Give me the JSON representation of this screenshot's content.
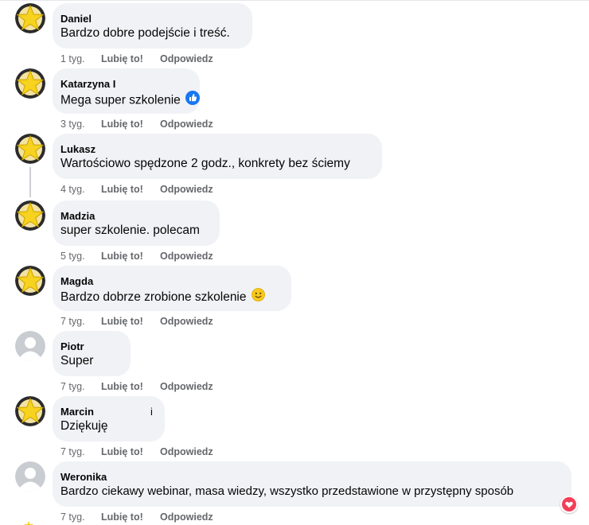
{
  "comments": [
    {
      "author": "Daniel",
      "text": "Bardzo dobre podejście i treść.",
      "time": "1 tyg.",
      "avatar": "star",
      "emoji": ""
    },
    {
      "author": "Katarzyna I",
      "text": "Mega super szkolenie",
      "time": "3 tyg.",
      "avatar": "star",
      "emoji": "thumbs-up-icon"
    },
    {
      "author": "Lukasz",
      "text": "Wartościowo spędzone 2 godz., konkrety bez ściemy",
      "time": "4 tyg.",
      "avatar": "star",
      "emoji": ""
    },
    {
      "author": "Madzia",
      "text": "super szkolenie. polecam",
      "time": "5 tyg.",
      "avatar": "star",
      "emoji": ""
    },
    {
      "author": "Magda",
      "text": "Bardzo dobrze zrobione szkolenie",
      "time": "7 tyg.",
      "avatar": "star",
      "emoji": "smiley-icon"
    },
    {
      "author": "Piotr",
      "text": "Super",
      "time": "7 tyg.",
      "avatar": "default",
      "emoji": ""
    },
    {
      "author": "Marcin",
      "author_suffix": "i",
      "text": "Dziękuję",
      "time": "7 tyg.",
      "avatar": "star",
      "emoji": ""
    },
    {
      "author": "Weronika",
      "text": "Bardzo ciekawy webinar, masa wiedzy, wszystko przedstawione w przystępny sposób",
      "time": "7 tyg.",
      "avatar": "default",
      "emoji": "",
      "reaction": "heart-icon"
    }
  ],
  "actions": {
    "like_label": "Lubię to!",
    "reply_label": "Odpowiedz"
  },
  "colors": {
    "bubble": "#f0f2f5",
    "meta_text": "#65676b",
    "star_fill": "#f7d21e",
    "star_ring": "#2b2b2b",
    "like_blue": "#1877f2",
    "heart_red": "#f33e58"
  }
}
